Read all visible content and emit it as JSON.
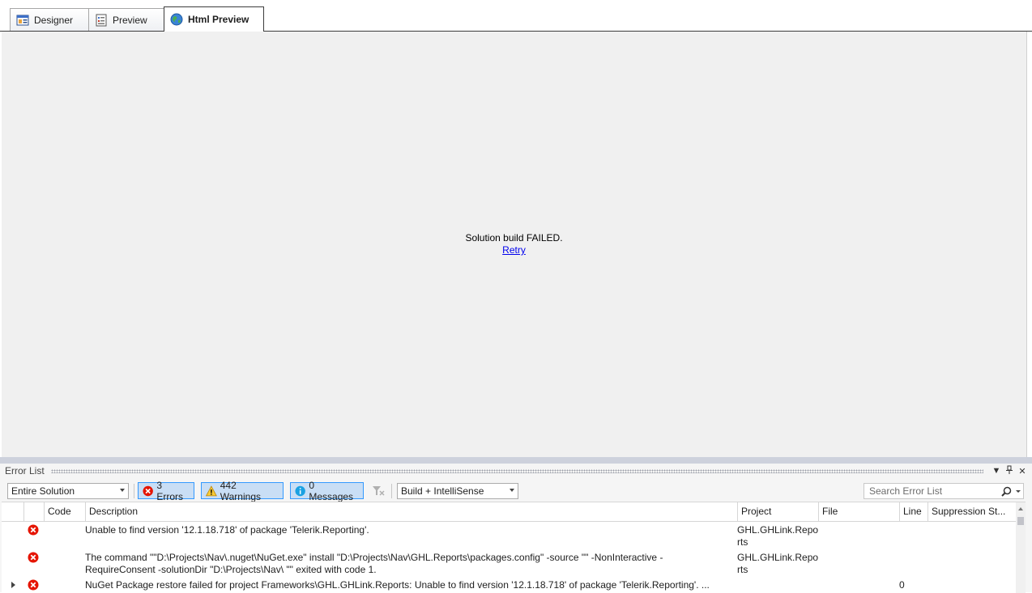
{
  "tabs": [
    {
      "label": "Designer",
      "icon": "designer-icon"
    },
    {
      "label": "Preview",
      "icon": "preview-icon"
    },
    {
      "label": "Html Preview",
      "icon": "globe-icon",
      "active": true
    }
  ],
  "preview": {
    "status": "Solution build FAILED.",
    "retry_label": "Retry"
  },
  "error_list": {
    "title": "Error List",
    "title_controls": [
      "dropdown-arrow-icon",
      "pin-icon",
      "close-icon"
    ],
    "scope": "Entire Solution",
    "errors_label": "3 Errors",
    "warnings_label": "442 Warnings",
    "messages_label": "0 Messages",
    "build_source": "Build + IntelliSense",
    "search_placeholder": "Search Error List",
    "columns": {
      "code": "Code",
      "description": "Description",
      "project": "Project",
      "file": "File",
      "line": "Line",
      "suppression": "Suppression St..."
    },
    "rows": [
      {
        "icon": "error-icon",
        "code": "",
        "description_lines": [
          "Unable to find version '12.1.18.718' of package 'Telerik.Reporting'."
        ],
        "project_lines": [
          "GHL.GHLink.Repo",
          "rts"
        ],
        "file": "",
        "line": "",
        "expandable": false
      },
      {
        "icon": "error-icon",
        "code": "",
        "description_lines": [
          "The command \"\"D:\\Projects\\Nav\\.nuget\\NuGet.exe\" install \"D:\\Projects\\Nav\\GHL.Reports\\packages.config\" -source \"\"  -NonInteractive -",
          "RequireConsent -solutionDir \"D:\\Projects\\Nav\\ \"\" exited with code 1."
        ],
        "project_lines": [
          "GHL.GHLink.Repo",
          "rts"
        ],
        "file": "",
        "line": "",
        "expandable": false
      },
      {
        "icon": "error-icon",
        "code": "",
        "description_lines": [
          "NuGet Package restore failed for project Frameworks\\GHL.GHLink.Reports: Unable to find version '12.1.18.718' of package 'Telerik.Reporting'. ..."
        ],
        "project_lines": [
          ""
        ],
        "file": "",
        "line": "0",
        "expandable": true
      }
    ]
  },
  "colors": {
    "preview_bg": "#f0f0f0",
    "splitter": "#cdd1dc",
    "panel_bg": "#f5f5f5",
    "active_filter_bg": "#c9def5",
    "active_filter_border": "#3399ff",
    "error_red": "#e51400",
    "warning_yellow": "#f7c935",
    "info_blue": "#1ba1e2",
    "link": "#0000ee"
  }
}
